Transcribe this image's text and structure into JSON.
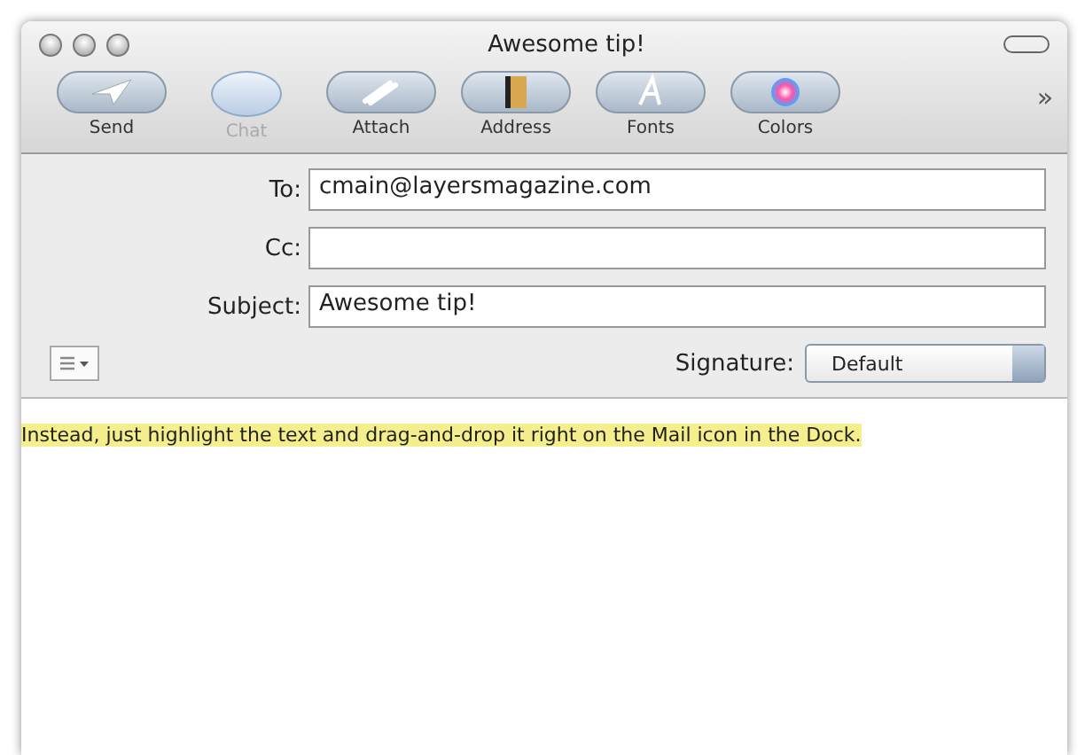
{
  "window": {
    "title": "Awesome tip!"
  },
  "toolbar": [
    {
      "label": "Send",
      "kind": "send",
      "disabled": false
    },
    {
      "label": "Chat",
      "kind": "chat",
      "disabled": true
    },
    {
      "label": "Attach",
      "kind": "attach",
      "disabled": false
    },
    {
      "label": "Address",
      "kind": "address",
      "disabled": false
    },
    {
      "label": "Fonts",
      "kind": "fonts",
      "disabled": false
    },
    {
      "label": "Colors",
      "kind": "colors",
      "disabled": false
    }
  ],
  "overflow": "»",
  "fields": [
    {
      "label": "To:",
      "value": "cmain@layersmagazine.com"
    },
    {
      "label": "Cc:"
    },
    {
      "label": "Subject:",
      "value": "Awesome tip!"
    }
  ],
  "signature": {
    "label": "Signature:",
    "value": "Default"
  },
  "body": {
    "text": "Instead, just highlight the text and drag-and-drop it right on the Mail icon in the Dock.",
    "highlighted": true
  }
}
